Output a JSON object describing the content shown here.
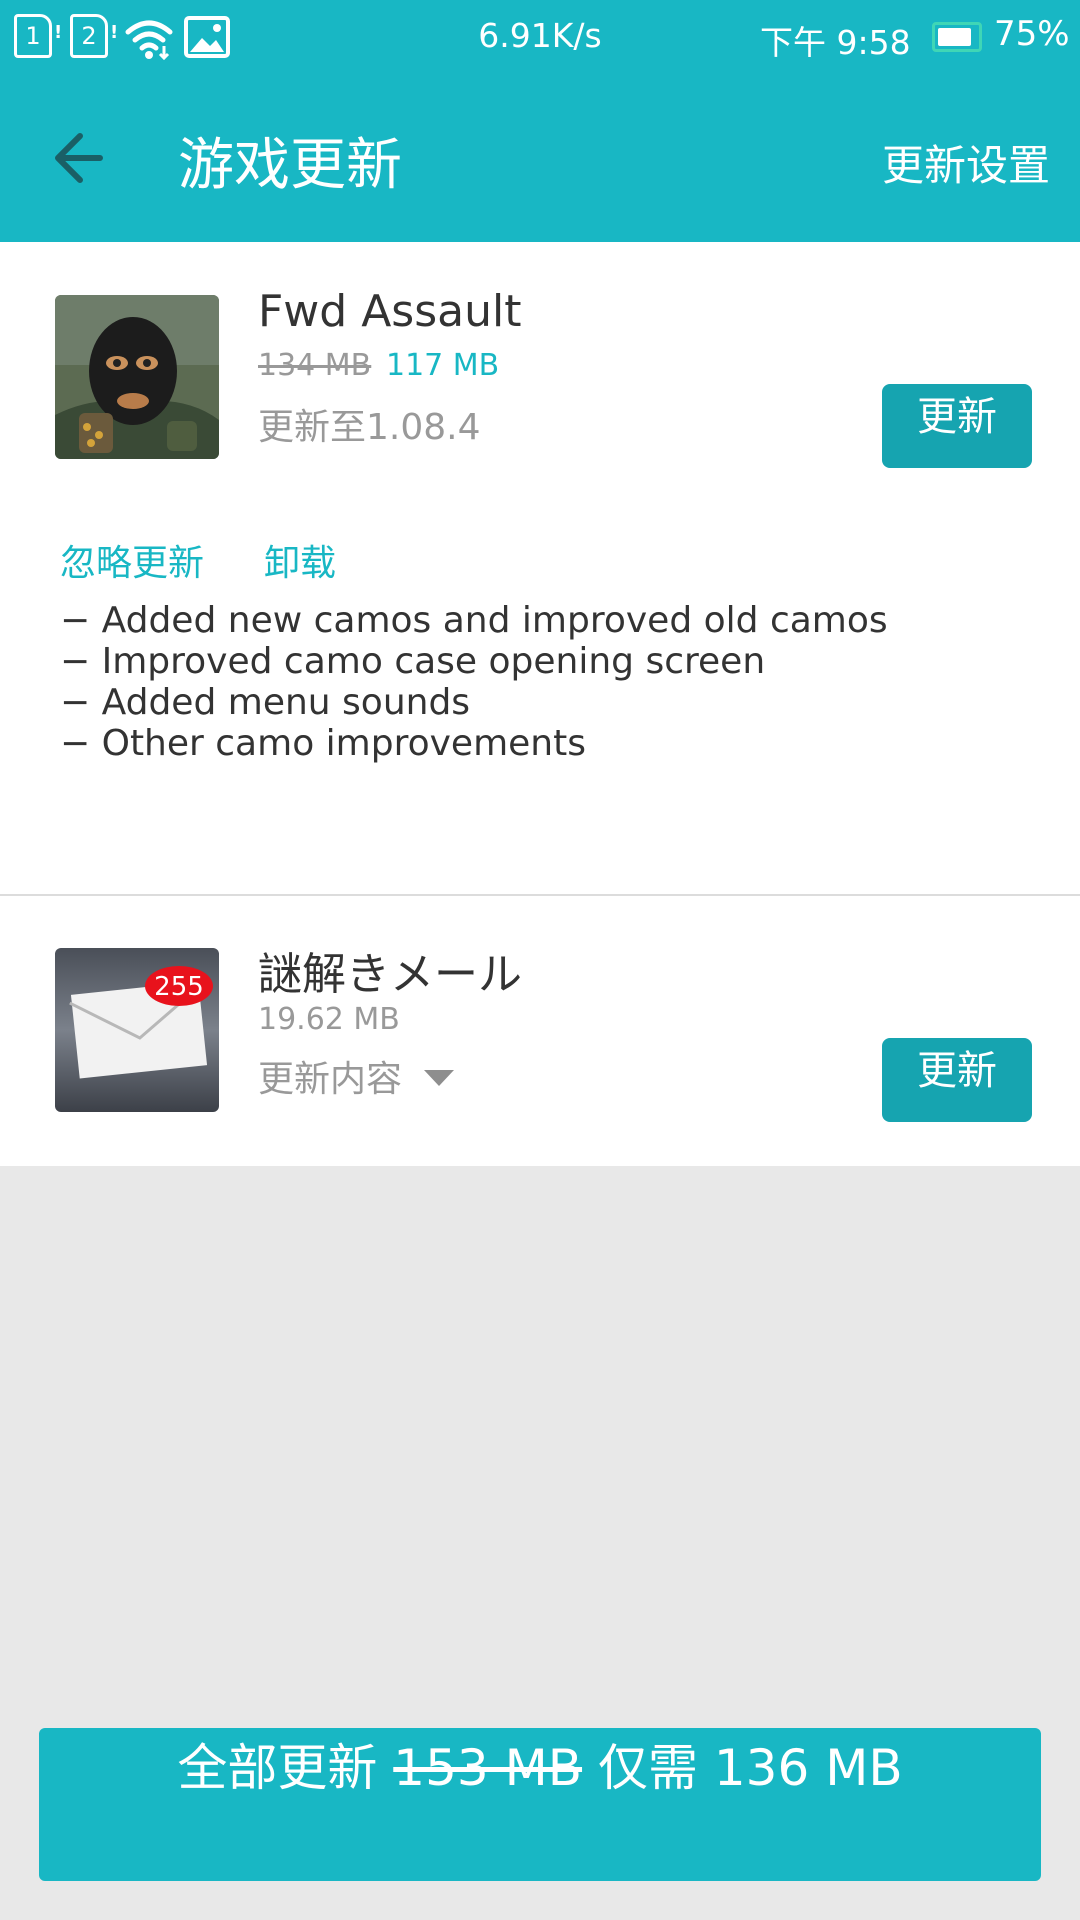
{
  "status_bar": {
    "sim1": "1",
    "sim2": "2",
    "net_speed": "6.91K/s",
    "time": "下午 9:58",
    "battery": "75%",
    "icons": [
      "sim1-icon",
      "sim2-icon",
      "wifi-icon",
      "image-icon",
      "battery-icon"
    ]
  },
  "app_bar": {
    "title": "游戏更新",
    "settings_label": "更新设置",
    "back_icon": "arrow-left-icon",
    "color": "#18b7c4"
  },
  "updates": [
    {
      "name": "Fwd Assault",
      "size_old": "134 MB",
      "size_new": "117 MB",
      "version_line": "更新至1.08.4",
      "update_label": "更新",
      "ignore_label": "忽略更新",
      "uninstall_label": "卸载",
      "changelog": [
        "− Added new camos and improved old camos",
        "− Improved camo case opening screen",
        "− Added menu sounds",
        "− Other camo improvements"
      ]
    },
    {
      "name": "謎解きメール",
      "size": "19.62 MB",
      "details_label": "更新内容",
      "update_label": "更新",
      "badge_count": "255"
    }
  ],
  "footer": {
    "label": "全部更新",
    "size_old": "153 MB",
    "only_label": "仅需",
    "size_new": "136 MB"
  },
  "colors": {
    "accent": "#18b7c4",
    "button": "#16a4b0",
    "background": "#e8e8e8"
  }
}
